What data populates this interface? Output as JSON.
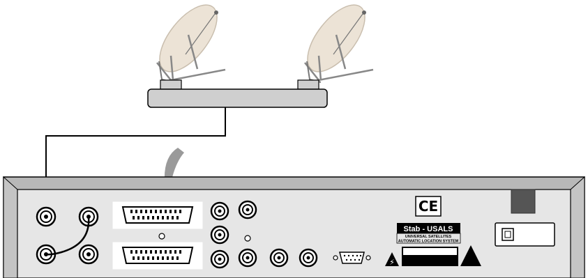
{
  "labels": {
    "ce_mark": "CE",
    "usals_title": "Stab - USALS",
    "usals_line1": "UNIVERSAL SATELLITES",
    "usals_line2": "AUTOMATIC LOCATION SYSTEM",
    "warning_symbol": "⚡"
  },
  "colors": {
    "dish": "#ece3d6",
    "dish_edge": "#c9beae",
    "panel": "#e6e6e6",
    "bevel": "#b8b8b8",
    "switch_box": "#cfcfcf",
    "connector_fill": "#ffffff",
    "stroke": "#000000"
  }
}
